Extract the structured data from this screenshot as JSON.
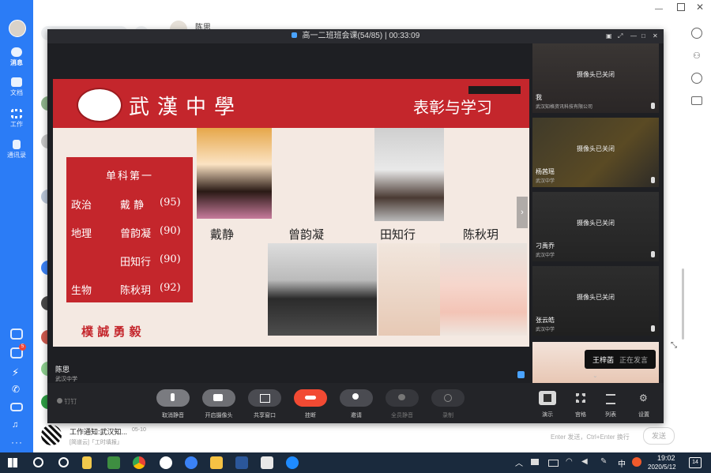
{
  "window": {
    "chat_title": "陈思",
    "meeting_title": "高一二班班会课(54/85) | 00:33:09"
  },
  "sidebar": {
    "items": [
      {
        "label": "消息"
      },
      {
        "label": "文档"
      },
      {
        "label": "工作"
      },
      {
        "label": "通讯录"
      }
    ],
    "badge": "5"
  },
  "chatlist": {
    "last_item_title": "工作通知:武汉知...",
    "last_item_date": "05-10",
    "last_item_sub": "[简道云]「工时填报」"
  },
  "slide": {
    "school_name": "武漢中學",
    "title": "表彰与学习",
    "box_heading": "单科第一",
    "rows": [
      {
        "subject": "政治",
        "name": "戴 静",
        "score": "(95)"
      },
      {
        "subject": "地理",
        "name": "曾韵凝",
        "score": "(90)"
      },
      {
        "subject": "",
        "name": "田知行",
        "score": "(90)"
      },
      {
        "subject": "生物",
        "name": "陈秋玥",
        "score": "(92)"
      }
    ],
    "motto": "樸 誠 勇 毅",
    "students": [
      "戴静",
      "曾韵凝",
      "田知行",
      "陈秋玥"
    ]
  },
  "presenter": {
    "name": "陈思",
    "org": "武汉中学"
  },
  "participants": [
    {
      "name": "我",
      "org": "武汉知格资讯科技有限公司",
      "status": "摄像头已关闭"
    },
    {
      "name": "杨茜瑶",
      "org": "武汉中学",
      "status": "摄像头已关闭"
    },
    {
      "name": "刁禹乔",
      "org": "武汉中学",
      "status": "摄像头已关闭"
    },
    {
      "name": "张云皓",
      "org": "武汉中学",
      "status": "摄像头已关闭"
    }
  ],
  "speaking": {
    "name": "王梓菡",
    "status": "正在发言"
  },
  "toolbar": {
    "brand": "钉钉",
    "unmute": "取消静音",
    "camera": "开启摄像头",
    "share": "共享窗口",
    "hangup": "挂断",
    "invite": "邀请",
    "mute_all": "全员静音",
    "record": "录制",
    "layout1": "演示",
    "layout2": "宫格",
    "layout3": "列表",
    "settings": "设置"
  },
  "input": {
    "hint": "Enter 发送，Ctrl+Enter 换行",
    "send": "发送"
  },
  "taskbar": {
    "ime": "中",
    "time": "19:02",
    "date": "2020/5/12",
    "notif": "14"
  },
  "colors": {
    "sidebar": "#2b7cf6",
    "slide_red": "#c4262c",
    "hangup": "#f24a33"
  }
}
